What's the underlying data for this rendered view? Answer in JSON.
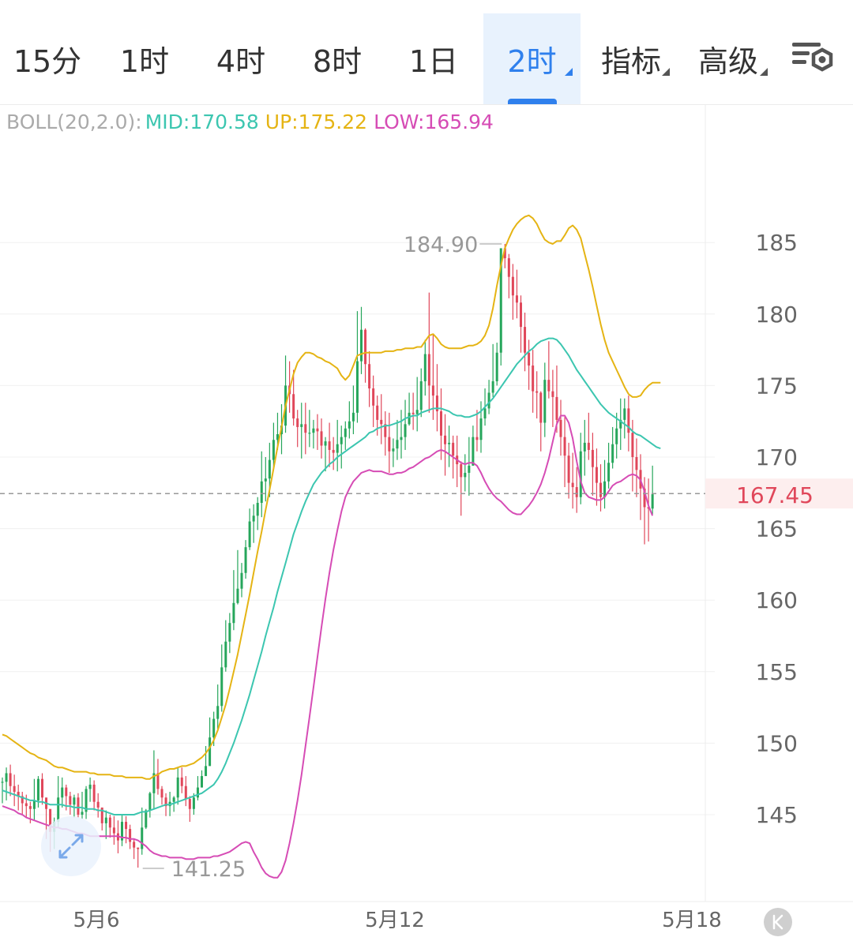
{
  "tabs": [
    {
      "label": "15分",
      "active": false,
      "dropdown": false
    },
    {
      "label": "1时",
      "active": false,
      "dropdown": false
    },
    {
      "label": "4时",
      "active": false,
      "dropdown": false
    },
    {
      "label": "8时",
      "active": false,
      "dropdown": false
    },
    {
      "label": "1日",
      "active": false,
      "dropdown": false
    },
    {
      "label": "2时",
      "active": true,
      "dropdown": true
    },
    {
      "label": "指标",
      "active": false,
      "dropdown": true
    },
    {
      "label": "高级",
      "active": false,
      "dropdown": true
    }
  ],
  "settings_icon": "chart-settings-icon",
  "legend": {
    "name": "BOLL(20,2.0):",
    "mid": "MID:170.58",
    "up": "UP:175.22",
    "low": "LOW:165.94"
  },
  "colors": {
    "up_candle": "#26a65b",
    "down_candle": "#e0475a",
    "mid": "#3cc6b0",
    "up": "#e5b414",
    "low": "#d64cb5",
    "accent": "#2f80ed",
    "price": "#e0475a"
  },
  "chart_data": {
    "type": "candlestick",
    "indicator": "BOLL(20,2.0)",
    "ylim": [
      139.5,
      189
    ],
    "y_ticks": [
      145,
      150,
      155,
      160,
      165,
      170,
      175,
      180,
      185
    ],
    "x_ticks": [
      "5月6",
      "5月12",
      "5月18"
    ],
    "current_price": "167.45",
    "high_label": "184.90",
    "low_label": "141.25",
    "close": [
      147.3,
      147.9,
      147.0,
      146.6,
      146.3,
      145.8,
      145.6,
      145.4,
      146.0,
      147.5,
      146.2,
      145.4,
      143.8,
      144.5,
      146.2,
      146.9,
      146.3,
      145.7,
      146.2,
      145.0,
      145.2,
      146.8,
      147.1,
      145.9,
      145.5,
      144.4,
      144.8,
      144.1,
      143.7,
      143.2,
      144.5,
      144.0,
      143.1,
      142.7,
      142.6,
      144.1,
      145.3,
      146.5,
      147.9,
      146.8,
      146.2,
      145.6,
      145.9,
      146.2,
      147.6,
      147.0,
      146.1,
      145.4,
      146.2,
      146.9,
      147.7,
      148.4,
      150.4,
      151.7,
      152.6,
      155.3,
      157.1,
      158.4,
      159.8,
      160.8,
      161.9,
      163.7,
      165.5,
      165.9,
      166.8,
      168.3,
      168.5,
      169.8,
      171.2,
      171.6,
      172.2,
      175.0,
      174.4,
      172.7,
      172.1,
      172.3,
      171.7,
      171.7,
      172.0,
      171.8,
      170.8,
      171.1,
      170.5,
      170.3,
      170.9,
      171.4,
      172.0,
      172.5,
      173.1,
      176.7,
      178.9,
      176.5,
      174.8,
      173.6,
      172.6,
      172.3,
      171.4,
      170.4,
      170.6,
      171.2,
      171.4,
      172.3,
      173.1,
      173.0,
      173.3,
      175.3,
      177.2,
      175.0,
      174.3,
      173.2,
      171.5,
      170.9,
      171.0,
      170.1,
      169.5,
      168.6,
      168.9,
      169.4,
      171.4,
      171.2,
      172.7,
      173.4,
      174.5,
      175.3,
      177.3,
      184.6,
      183.9,
      182.6,
      181.3,
      180.8,
      179.1,
      177.3,
      176.4,
      174.6,
      174.5,
      172.4,
      175.4,
      174.6,
      174.2,
      172.6,
      171.4,
      170.1,
      168.2,
      167.9,
      167.2,
      170.4,
      171.0,
      170.5,
      169.3,
      168.2,
      167.2,
      168.3,
      169.6,
      170.9,
      172.0,
      172.6,
      173.4,
      171.7,
      170.0,
      169.1,
      167.8,
      166.5,
      166.4,
      167.4
    ],
    "high": [
      147.6,
      148.3,
      148.5,
      147.8,
      147.1,
      146.6,
      146.4,
      145.9,
      147.5,
      147.7,
      147.9,
      145.7,
      144.3,
      144.8,
      147.7,
      147.6,
      147.1,
      146.6,
      146.4,
      146.5,
      146.6,
      147.0,
      147.6,
      147.4,
      146.5,
      145.5,
      145.3,
      145.0,
      144.9,
      144.6,
      145.0,
      144.9,
      144.3,
      143.3,
      142.7,
      145.5,
      145.4,
      146.6,
      149.5,
      148.9,
      147.0,
      146.5,
      146.6,
      146.3,
      148.3,
      148.3,
      147.7,
      146.3,
      146.5,
      147.7,
      148.1,
      149.8,
      151.8,
      152.2,
      154.1,
      156.9,
      158.6,
      159.1,
      162.1,
      163.5,
      162.6,
      164.2,
      166.4,
      166.7,
      167.2,
      170.4,
      170.0,
      171.0,
      172.4,
      173.1,
      173.7,
      177.1,
      176.7,
      176.1,
      173.3,
      173.8,
      173.8,
      173.3,
      172.6,
      173.0,
      172.7,
      171.4,
      172.4,
      171.4,
      172.6,
      172.2,
      172.5,
      173.9,
      175.0,
      180.2,
      180.5,
      179.0,
      177.4,
      175.7,
      174.3,
      174.4,
      173.2,
      173.1,
      171.3,
      172.6,
      173.3,
      174.0,
      174.5,
      174.5,
      175.6,
      176.2,
      178.2,
      181.5,
      178.6,
      176.5,
      174.8,
      173.0,
      172.2,
      171.5,
      171.5,
      169.7,
      170.2,
      171.4,
      172.2,
      173.3,
      173.9,
      174.8,
      175.4,
      177.9,
      178.0,
      184.6,
      184.9,
      184.2,
      183.5,
      183.1,
      181.3,
      180.1,
      178.2,
      177.5,
      176.0,
      174.6,
      176.6,
      178.1,
      176.1,
      176.4,
      174.0,
      172.8,
      171.0,
      170.3,
      169.3,
      171.7,
      172.6,
      173.1,
      171.7,
      170.6,
      169.5,
      169.8,
      171.0,
      172.1,
      173.1,
      174.1,
      174.1,
      174.3,
      172.6,
      171.3,
      170.2,
      168.6,
      168.5,
      169.4
    ],
    "low": [
      145.8,
      146.0,
      146.3,
      145.6,
      145.3,
      145.0,
      144.8,
      144.4,
      144.6,
      145.5,
      145.7,
      143.3,
      142.4,
      142.6,
      144.1,
      145.5,
      145.3,
      145.0,
      144.8,
      144.8,
      144.7,
      144.7,
      145.9,
      145.3,
      144.8,
      143.9,
      143.3,
      143.4,
      142.9,
      142.3,
      142.8,
      143.0,
      142.6,
      141.9,
      141.3,
      142.2,
      144.0,
      144.8,
      145.4,
      146.4,
      145.7,
      144.9,
      144.9,
      145.2,
      145.7,
      146.5,
      145.6,
      144.5,
      145.0,
      146.0,
      146.9,
      147.8,
      148.5,
      149.8,
      151.0,
      152.2,
      155.0,
      156.3,
      157.9,
      159.7,
      160.2,
      161.5,
      163.5,
      164.0,
      164.9,
      165.8,
      166.9,
      167.2,
      169.2,
      170.5,
      170.2,
      171.7,
      173.1,
      172.2,
      170.7,
      169.9,
      170.2,
      170.7,
      170.6,
      170.5,
      169.9,
      169.0,
      169.3,
      169.1,
      169.0,
      169.2,
      170.5,
      171.3,
      171.6,
      172.4,
      175.8,
      175.2,
      173.5,
      172.1,
      171.5,
      170.9,
      170.1,
      168.9,
      169.3,
      169.8,
      169.9,
      170.5,
      172.2,
      171.9,
      171.8,
      172.8,
      174.3,
      173.1,
      172.6,
      171.8,
      169.8,
      168.7,
      169.3,
      168.5,
      167.9,
      165.9,
      167.6,
      167.3,
      169.4,
      170.4,
      170.3,
      172.2,
      173.0,
      174.2,
      175.0,
      176.4,
      183.2,
      181.1,
      179.6,
      179.7,
      177.3,
      176.0,
      174.7,
      173.1,
      172.7,
      170.4,
      171.4,
      174.1,
      172.1,
      171.7,
      170.1,
      167.9,
      167.1,
      166.4,
      166.1,
      166.7,
      168.7,
      169.8,
      167.3,
      166.6,
      166.2,
      166.4,
      167.8,
      169.2,
      169.9,
      170.5,
      171.3,
      170.4,
      167.6,
      167.2,
      165.6,
      163.9,
      164.1,
      166.0
    ],
    "boll_mid": [
      146.7,
      146.6,
      146.5,
      146.4,
      146.3,
      146.2,
      146.1,
      146.0,
      146.0,
      145.9,
      145.9,
      145.8,
      145.7,
      145.7,
      145.7,
      145.7,
      145.6,
      145.6,
      145.5,
      145.5,
      145.5,
      145.4,
      145.4,
      145.4,
      145.3,
      145.3,
      145.2,
      145.1,
      145.0,
      145.0,
      145.0,
      145.0,
      145.0,
      145.0,
      145.1,
      145.2,
      145.2,
      145.3,
      145.4,
      145.5,
      145.6,
      145.7,
      145.7,
      145.8,
      145.9,
      146.0,
      146.1,
      146.2,
      146.3,
      146.4,
      146.5,
      146.7,
      146.9,
      147.1,
      147.5,
      148.0,
      148.6,
      149.3,
      150.0,
      150.8,
      151.6,
      152.5,
      153.4,
      154.4,
      155.4,
      156.4,
      157.5,
      158.5,
      159.5,
      160.6,
      161.6,
      162.6,
      163.6,
      164.6,
      165.4,
      166.2,
      166.9,
      167.5,
      168.1,
      168.5,
      168.9,
      169.2,
      169.5,
      169.7,
      170.0,
      170.2,
      170.4,
      170.6,
      170.8,
      171.0,
      171.2,
      171.4,
      171.7,
      171.8,
      172.0,
      172.1,
      172.2,
      172.2,
      172.3,
      172.4,
      172.5,
      172.7,
      172.8,
      172.9,
      172.9,
      173.1,
      173.2,
      173.3,
      173.4,
      173.4,
      173.4,
      173.3,
      173.2,
      173.0,
      172.9,
      172.9,
      172.8,
      172.8,
      172.9,
      173.0,
      173.2,
      173.5,
      173.8,
      174.1,
      174.5,
      174.9,
      175.3,
      175.7,
      176.1,
      176.5,
      176.8,
      177.1,
      177.4,
      177.6,
      177.9,
      178.1,
      178.2,
      178.3,
      178.3,
      178.2,
      177.9,
      177.5,
      177.1,
      176.6,
      176.1,
      175.7,
      175.3,
      174.9,
      174.5,
      174.1,
      173.7,
      173.4,
      173.1,
      172.9,
      172.7,
      172.5,
      172.3,
      172.1,
      171.8,
      171.6,
      171.5,
      171.3,
      171.1,
      170.9,
      170.7,
      170.6
    ],
    "boll_up": [
      150.6,
      150.5,
      150.3,
      150.1,
      149.9,
      149.7,
      149.5,
      149.3,
      149.2,
      149.0,
      148.9,
      148.8,
      148.6,
      148.4,
      148.3,
      148.3,
      148.2,
      148.1,
      148.0,
      148.0,
      148.0,
      148.0,
      147.9,
      147.9,
      147.8,
      147.8,
      147.8,
      147.8,
      147.7,
      147.7,
      147.7,
      147.6,
      147.6,
      147.6,
      147.6,
      147.6,
      147.5,
      147.5,
      147.7,
      147.8,
      148.0,
      148.1,
      148.2,
      148.2,
      148.3,
      148.4,
      148.4,
      148.5,
      148.6,
      148.8,
      149.0,
      149.3,
      149.7,
      150.2,
      150.9,
      151.8,
      152.7,
      153.8,
      155.0,
      156.2,
      157.6,
      159.0,
      160.4,
      161.9,
      163.4,
      164.8,
      166.3,
      167.7,
      169.2,
      170.7,
      172.1,
      173.6,
      174.7,
      175.8,
      176.6,
      177.0,
      177.3,
      177.3,
      177.2,
      177.0,
      176.9,
      176.7,
      176.6,
      176.4,
      176.2,
      175.7,
      175.4,
      175.7,
      176.4,
      177.1,
      177.2,
      177.3,
      177.3,
      177.3,
      177.3,
      177.3,
      177.4,
      177.4,
      177.4,
      177.5,
      177.5,
      177.6,
      177.6,
      177.6,
      177.7,
      177.7,
      178.1,
      178.5,
      178.6,
      178.3,
      177.9,
      177.7,
      177.6,
      177.6,
      177.6,
      177.6,
      177.7,
      177.8,
      177.8,
      177.9,
      178.1,
      178.5,
      179.2,
      180.4,
      182.0,
      183.4,
      184.6,
      185.3,
      185.9,
      186.3,
      186.6,
      186.8,
      186.9,
      186.7,
      186.3,
      185.7,
      185.2,
      185.0,
      184.9,
      185.1,
      185.1,
      185.5,
      186.0,
      186.2,
      185.9,
      185.3,
      184.2,
      183.1,
      181.9,
      180.6,
      179.3,
      178.2,
      177.3,
      176.7,
      176.1,
      175.5,
      174.9,
      174.4,
      174.2,
      174.2,
      174.3,
      174.7,
      175.0,
      175.2,
      175.2,
      175.2
    ],
    "boll_low": [
      145.6,
      145.5,
      145.4,
      145.3,
      145.1,
      145.0,
      144.8,
      144.7,
      144.6,
      144.5,
      144.4,
      144.3,
      144.2,
      144.1,
      144.1,
      144.0,
      144.0,
      143.9,
      143.8,
      143.7,
      143.7,
      143.6,
      143.5,
      143.5,
      143.5,
      143.5,
      143.5,
      143.5,
      143.5,
      143.5,
      143.4,
      143.4,
      143.3,
      143.3,
      143.2,
      143.0,
      142.8,
      142.5,
      142.3,
      142.2,
      142.1,
      142.1,
      142.0,
      142.0,
      142.0,
      142.0,
      141.9,
      141.9,
      141.9,
      142.0,
      142.0,
      142.0,
      142.0,
      142.1,
      142.1,
      142.2,
      142.3,
      142.4,
      142.6,
      142.8,
      143.0,
      143.1,
      143.0,
      142.4,
      141.9,
      141.3,
      140.9,
      140.7,
      140.6,
      140.6,
      141.0,
      141.8,
      143.0,
      144.4,
      146.0,
      147.8,
      149.8,
      151.8,
      153.9,
      156.0,
      158.1,
      160.1,
      161.9,
      163.5,
      164.9,
      166.2,
      167.2,
      167.8,
      168.3,
      168.6,
      168.9,
      169.0,
      169.1,
      169.0,
      169.0,
      169.0,
      168.9,
      168.8,
      168.8,
      168.9,
      168.9,
      169.0,
      169.2,
      169.3,
      169.5,
      169.7,
      169.9,
      170.0,
      170.2,
      170.4,
      170.5,
      170.4,
      170.2,
      170.0,
      169.8,
      169.6,
      169.5,
      169.6,
      169.6,
      169.4,
      168.9,
      168.3,
      167.8,
      167.4,
      167.1,
      166.9,
      166.6,
      166.3,
      166.1,
      166.0,
      166.0,
      166.3,
      166.6,
      167.0,
      167.5,
      168.1,
      168.9,
      169.9,
      171.1,
      172.3,
      172.9,
      172.9,
      172.4,
      171.3,
      169.7,
      168.3,
      167.5,
      167.2,
      167.1,
      167.0,
      167.0,
      167.2,
      167.6,
      168.0,
      168.2,
      168.3,
      168.5,
      168.7,
      168.8,
      168.7,
      168.4,
      167.6,
      166.6,
      165.9
    ]
  }
}
